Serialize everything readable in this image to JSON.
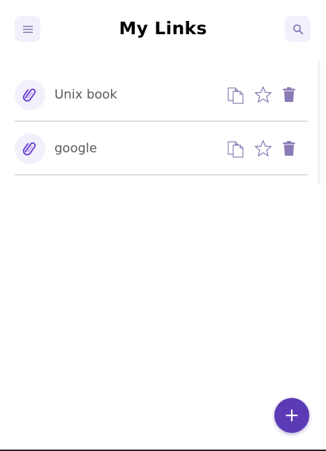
{
  "header": {
    "title": "My Links",
    "menu_icon": "menu-icon",
    "search_icon": "search-icon"
  },
  "links": [
    {
      "label": "Unix book",
      "icon": "paperclip-icon"
    },
    {
      "label": "google",
      "icon": "paperclip-icon"
    }
  ],
  "item_actions": [
    "copy-icon",
    "star-icon",
    "trash-icon"
  ],
  "fab": {
    "icon": "plus-icon"
  },
  "colors": {
    "accent": "#5b3bb5",
    "icon_soft": "#8a7ab5",
    "tile_bg": "#f2f0fa",
    "clip": "#7a56d6"
  }
}
